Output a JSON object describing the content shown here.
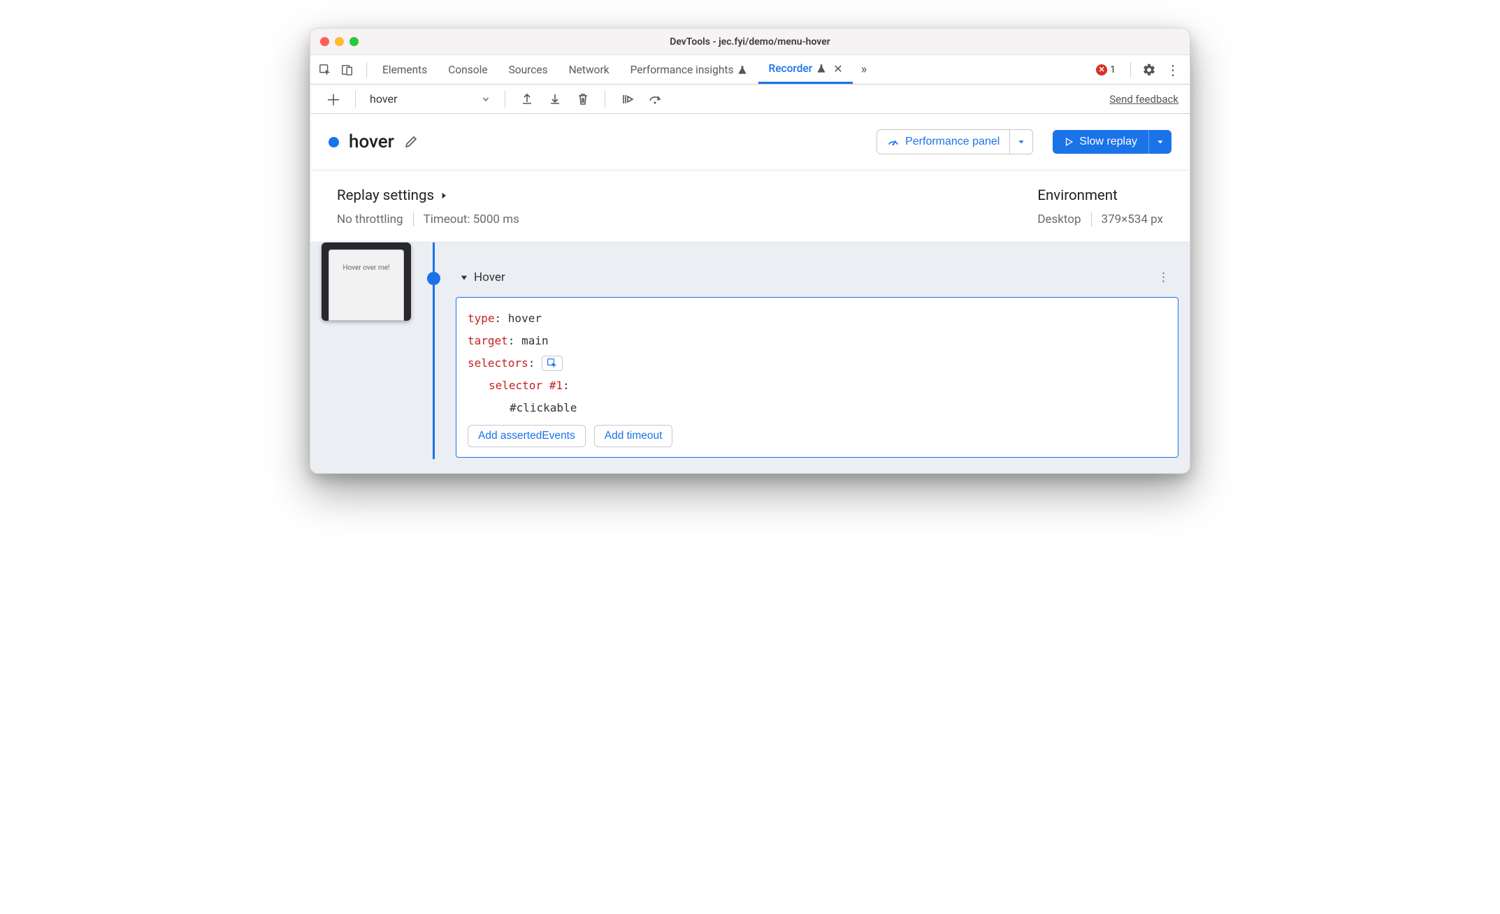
{
  "window": {
    "title": "DevTools - jec.fyi/demo/menu-hover"
  },
  "tabs": {
    "items": [
      "Elements",
      "Console",
      "Sources",
      "Network",
      "Performance insights",
      "Recorder"
    ],
    "active": "Recorder",
    "error_count": "1"
  },
  "subbar": {
    "dropdown_value": "hover",
    "feedback": "Send feedback"
  },
  "recording": {
    "name": "hover",
    "perf_button": "Performance panel",
    "replay_button": "Slow replay"
  },
  "settings": {
    "replay_title": "Replay settings",
    "throttling": "No throttling",
    "timeout": "Timeout: 5000 ms",
    "env_title": "Environment",
    "device": "Desktop",
    "dimensions": "379×534 px"
  },
  "thumbnail": {
    "text": "Hover over me!"
  },
  "step": {
    "title": "Hover",
    "props": {
      "type_key": "type",
      "type_val": "hover",
      "target_key": "target",
      "target_val": "main",
      "selectors_key": "selectors",
      "selector1_key": "selector #1",
      "selector1_val": "#clickable"
    },
    "actions": {
      "asserted": "Add assertedEvents",
      "timeout": "Add timeout"
    }
  }
}
